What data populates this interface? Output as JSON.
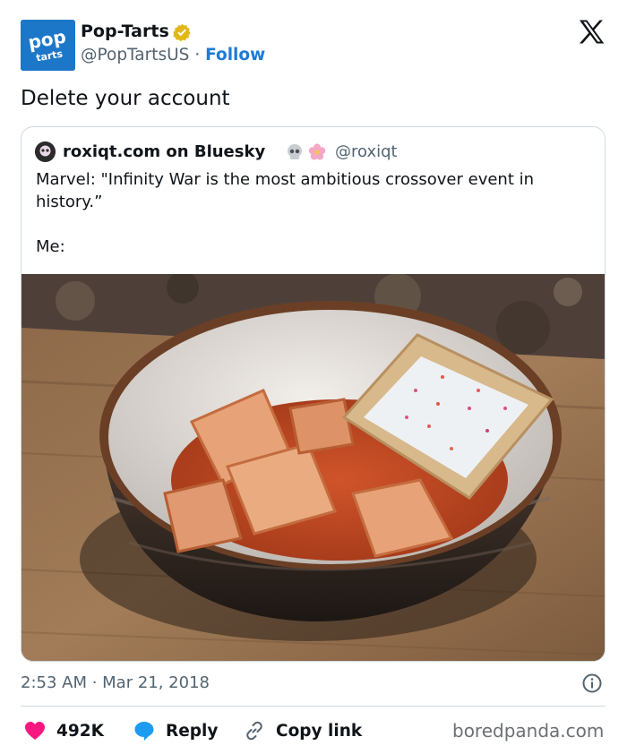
{
  "account": {
    "display_name": "Pop-Tarts",
    "handle": "@PopTartsUS",
    "separator": "·",
    "follow_label": "Follow",
    "logo_text_top": "pop",
    "logo_text_bottom": "tarts"
  },
  "tweet": {
    "text": "Delete your account"
  },
  "quote": {
    "author_name": "roxiqt.com on Bluesky",
    "emoji": [
      "skull-icon",
      "flower-icon"
    ],
    "author_handle": "@roxiqt",
    "lines": [
      "Marvel: \"Infinity War is the most ambitious crossover event in",
      "history.”",
      "",
      "Me:"
    ],
    "image_description_icon": "ravioli-and-pop-tart-bowl-photo"
  },
  "meta": {
    "timestamp": "2:53 AM · Mar 21, 2018"
  },
  "actions": {
    "like_count": "492K",
    "reply_label": "Reply",
    "copy_label": "Copy link"
  },
  "watermark": "boredpanda.com",
  "colors": {
    "accent_blue": "#1d7bd5",
    "like_red": "#f91880",
    "reply_blue": "#1d9bf0",
    "brand_blue": "#1d77c9",
    "verified_gold": "#e2b719"
  }
}
